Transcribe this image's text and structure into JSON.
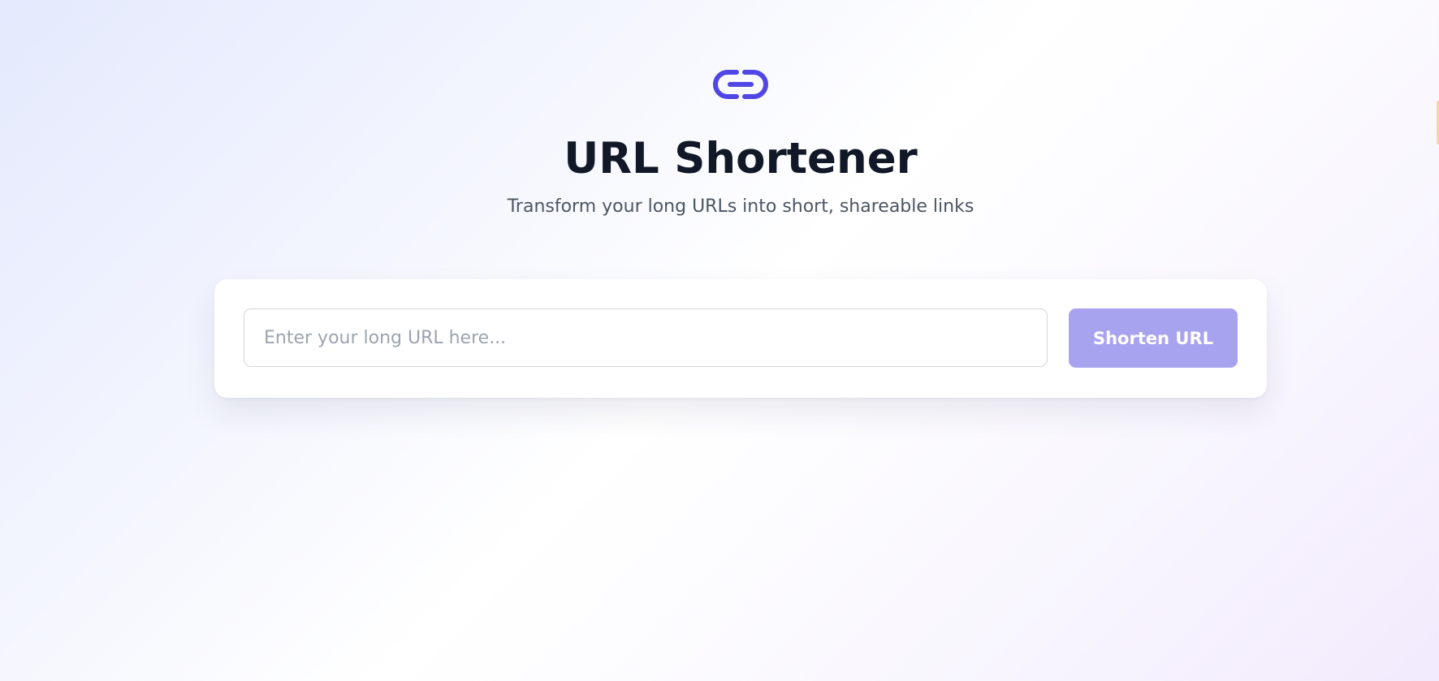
{
  "header": {
    "logo_icon": "link-icon",
    "title": "URL Shortener",
    "subtitle": "Transform your long URLs into short, shareable links"
  },
  "form": {
    "input_placeholder": "Enter your long URL here...",
    "input_value": "",
    "submit_label": "Shorten URL"
  },
  "colors": {
    "accent": "#4f46e5",
    "button_disabled": "#a8a3ef",
    "title_text": "#111827",
    "subtitle_text": "#4b5563"
  }
}
